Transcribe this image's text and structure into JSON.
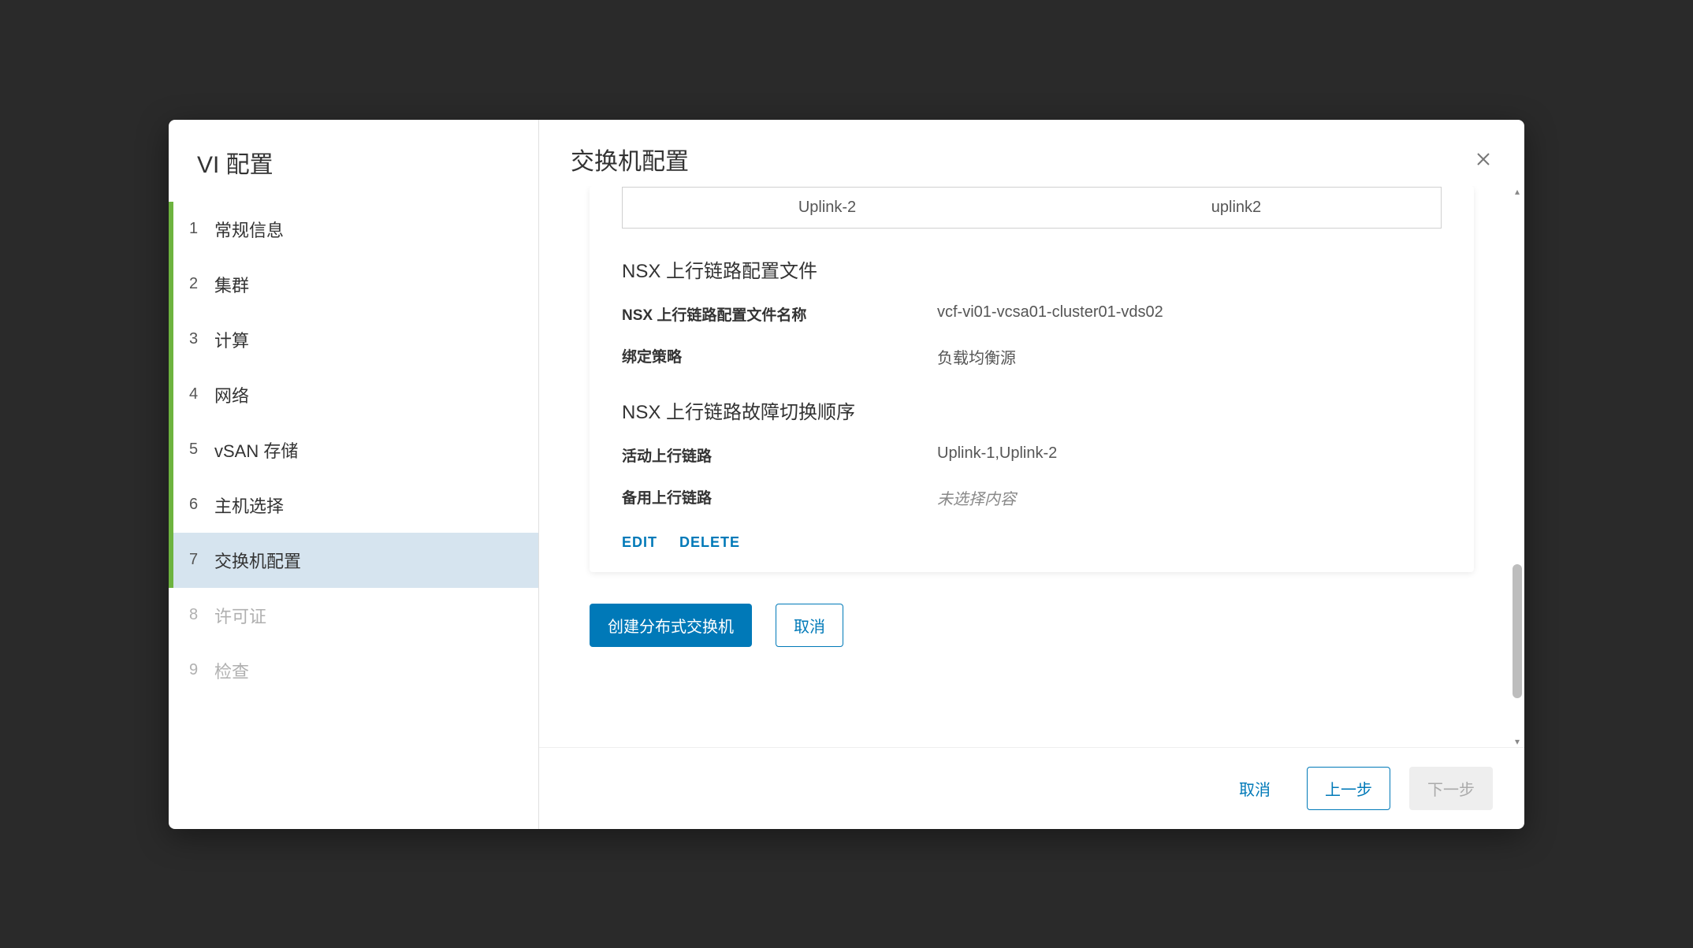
{
  "sidebar": {
    "title": "VI 配置",
    "steps": [
      {
        "num": "1",
        "label": "常规信息",
        "state": "completed"
      },
      {
        "num": "2",
        "label": "集群",
        "state": "completed"
      },
      {
        "num": "3",
        "label": "计算",
        "state": "completed"
      },
      {
        "num": "4",
        "label": "网络",
        "state": "completed"
      },
      {
        "num": "5",
        "label": "vSAN 存储",
        "state": "completed"
      },
      {
        "num": "6",
        "label": "主机选择",
        "state": "completed"
      },
      {
        "num": "7",
        "label": "交换机配置",
        "state": "active"
      },
      {
        "num": "8",
        "label": "许可证",
        "state": "pending"
      },
      {
        "num": "9",
        "label": "检查",
        "state": "pending"
      }
    ]
  },
  "main": {
    "title": "交换机配置",
    "uplink_row": {
      "left": "Uplink-2",
      "right": "uplink2"
    },
    "section_profile_title": "NSX 上行链路配置文件",
    "profile_name_label": "NSX 上行链路配置文件名称",
    "profile_name_value": "vcf-vi01-vcsa01-cluster01-vds02",
    "binding_label": "绑定策略",
    "binding_value": "负载均衡源",
    "section_failover_title": "NSX 上行链路故障切换顺序",
    "active_uplink_label": "活动上行链路",
    "active_uplink_value": "Uplink-1,Uplink-2",
    "standby_uplink_label": "备用上行链路",
    "standby_uplink_value": "未选择内容",
    "edit_label": "EDIT",
    "delete_label": "DELETE",
    "create_switch_label": "创建分布式交换机",
    "cancel_inner_label": "取消"
  },
  "footer": {
    "cancel_label": "取消",
    "prev_label": "上一步",
    "next_label": "下一步"
  }
}
